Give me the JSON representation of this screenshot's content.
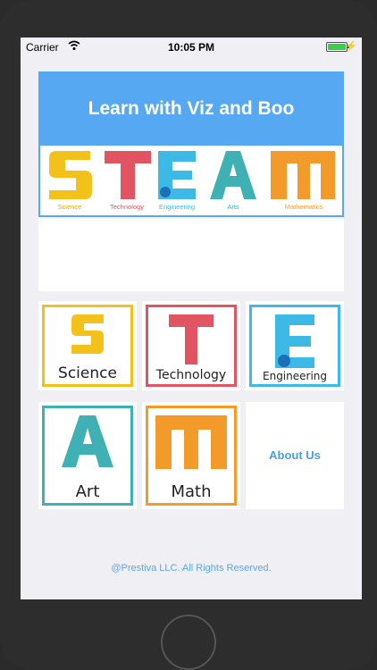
{
  "status_bar": {
    "carrier": "Carrier",
    "time": "10:05 PM"
  },
  "header": {
    "title": "Learn with Viz and Boo",
    "steam_captions": [
      "Science",
      "Technology",
      "Engineering",
      "Arts",
      "Mathematics"
    ]
  },
  "tiles": {
    "science": "Science",
    "technology": "Technology",
    "engineering": "Engineering",
    "art": "Art",
    "math": "Math",
    "about": "About Us"
  },
  "footer": "@Prestiva LLC. All Rights Reserved.",
  "colors": {
    "header_band": "#56a8f2",
    "science": "#f2c21b",
    "technology": "#e05561",
    "engineering": "#3db9e6",
    "art": "#3fb1b4",
    "math": "#f39b2a",
    "link": "#4a9fdf"
  }
}
